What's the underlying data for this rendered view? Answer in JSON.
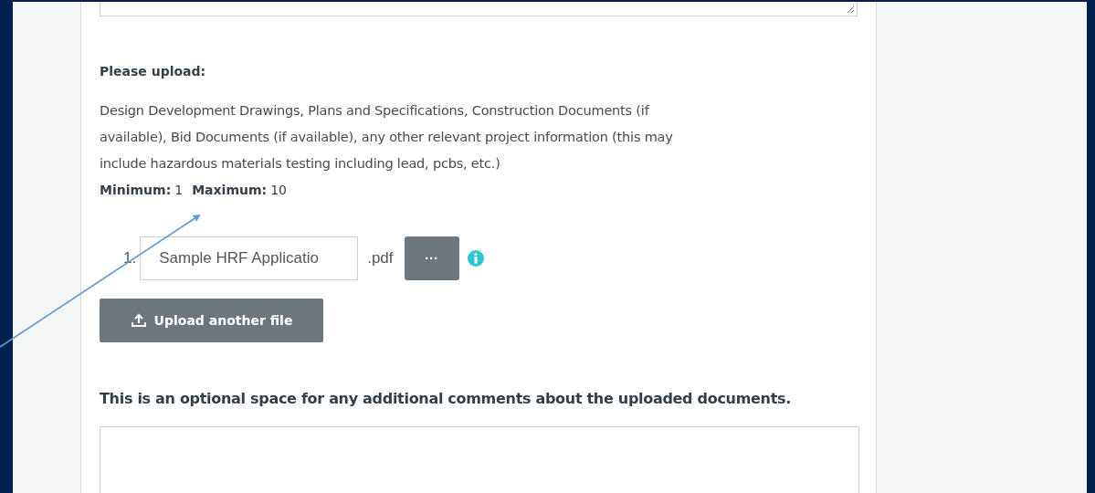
{
  "upload_question": {
    "title": "Please upload:",
    "description": "Design Development Drawings, Plans and Specifications, Construction Documents (if available), Bid Documents (if available), any other relevant project information (this may include hazardous materials testing including lead, pcbs, etc.)",
    "limits": [
      {
        "label": "Minimum:",
        "value": "1"
      },
      {
        "label": "Maximum:",
        "value": "10"
      }
    ],
    "files": [
      {
        "number": "1.",
        "name": "Sample HRF Applicatio",
        "extension": ".pdf",
        "menu": "···"
      }
    ],
    "upload_button": "Upload another file"
  },
  "comments_question": {
    "title": "This is an optional space for any additional comments about the uploaded documents."
  }
}
